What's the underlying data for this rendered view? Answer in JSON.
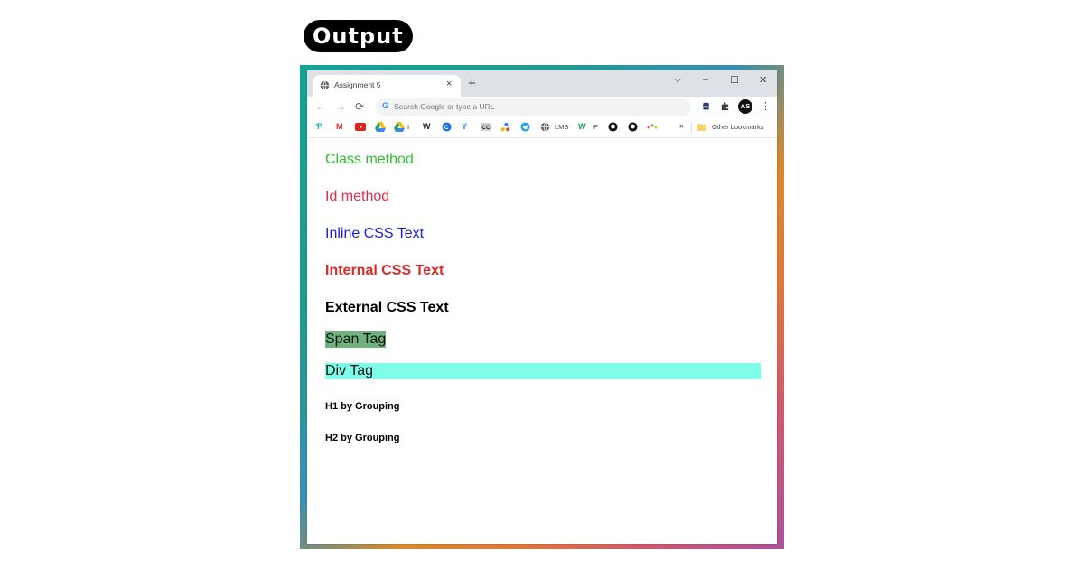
{
  "badge": "Output",
  "browser": {
    "tab_title": "Assignment 5",
    "tab_close": "×",
    "new_tab": "+",
    "win_dropdown": "⌵",
    "win_minimize": "–",
    "win_maximize": "☐",
    "win_close": "✕",
    "back": "←",
    "forward": "→",
    "reload": "⟳",
    "omnibox_placeholder": "Search Google or type a URL",
    "avatar_initials": "AS",
    "menu": "⋮",
    "bookmarks": {
      "items": [
        "I",
        "LMS",
        "P"
      ],
      "overflow": "»",
      "other": "Other bookmarks"
    }
  },
  "page": {
    "class_method": "Class method",
    "id_method": "Id method",
    "inline_css": "Inline CSS Text",
    "internal_css": "Internal CSS Text",
    "external_css": "External CSS Text",
    "span_tag": "Span Tag",
    "div_tag": "Div Tag",
    "h1_grouping": "H1 by Grouping",
    "h2_grouping": "H2 by Grouping"
  },
  "colors": {
    "class_method": "#2dbf2d",
    "id_method": "#d8314a",
    "inline_css": "#1a1ae6",
    "internal_css": "#d72a2a",
    "span_bg": "#6fb37c",
    "div_bg": "#7fffea"
  }
}
